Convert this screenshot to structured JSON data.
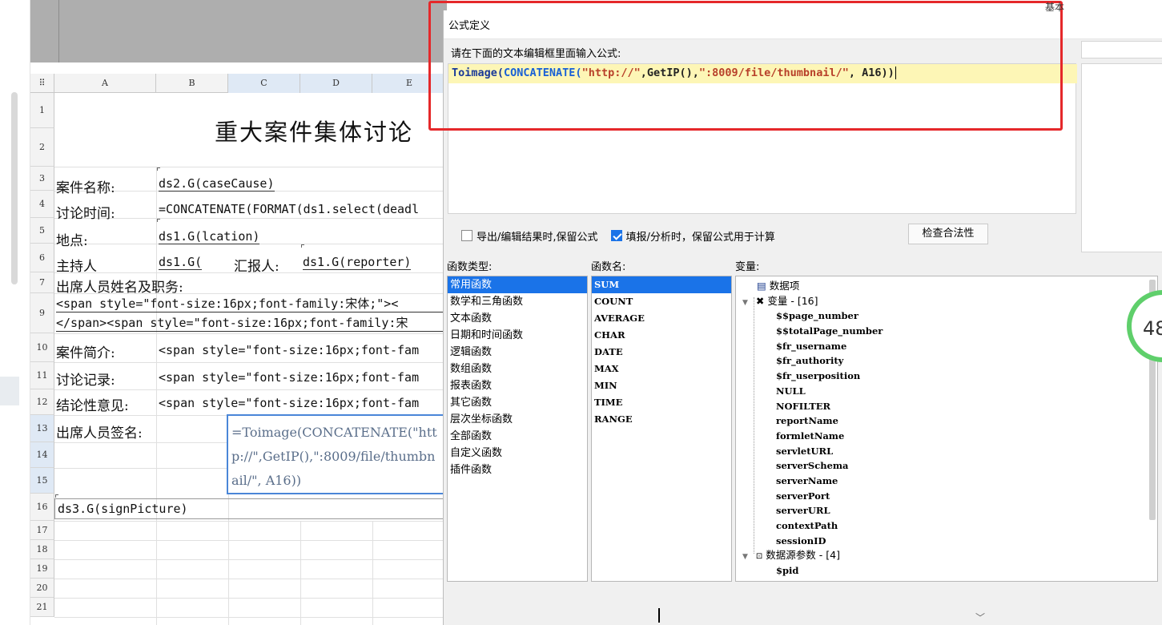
{
  "sheet": {
    "columns": [
      "A",
      "B",
      "C",
      "D",
      "E"
    ],
    "rows": [
      "1",
      "2",
      "3",
      "4",
      "5",
      "6",
      "7",
      "9",
      "10",
      "11",
      "12",
      "13",
      "14",
      "15",
      "16",
      "17",
      "18",
      "19",
      "20",
      "21"
    ],
    "title": "重大案件集体讨论",
    "cells": {
      "r3_label": "案件名称:",
      "r3_value": "ds2.G(caseCause)",
      "r4_label": "讨论时间:",
      "r4_value": "=CONCATENATE(FORMAT(ds1.select(deadl",
      "r5_label": "地点:",
      "r5_value": "ds1.G(lcation)",
      "r6_label": "主持人",
      "r6_value": "ds1.G(",
      "r6_label2": "汇报人:",
      "r6_value2": "ds1.G(reporter)",
      "r7_label": "出席人员姓名及职务:",
      "r9_line1": "<span style=\"font-size:16px;font-family:宋体;\"><",
      "r9_line2": "</span><span style=\"font-size:16px;font-family:宋",
      "r10_label": "案件简介:",
      "r10_value": "<span style=\"font-size:16px;font-fam",
      "r11_label": "讨论记录:",
      "r11_value": "<span style=\"font-size:16px;font-fam",
      "r12_label": "结论性意见:",
      "r12_value": "<span style=\"font-size:16px;font-fam",
      "r13_label": "出席人员签名:",
      "r13_formula": "=Toimage(CONCATENATE(\"http://\",GetIP(),\":8009/file/thumbnail/\", A16))",
      "r16_value": "ds3.G(signPicture)"
    }
  },
  "dialog": {
    "title": "公式定义",
    "instruction": "请在下面的文本编辑框里面输入公式:",
    "formula_tokens": {
      "t1": "Toimage(",
      "t2": "CONCATENATE(",
      "t3": "\"http://\"",
      "t4": ",GetIP(),",
      "t5": "\":8009/file/thumbnail/\"",
      "t6": ", A16))"
    },
    "option_export": "导出/编辑结果时,保留公式",
    "option_fill": "填报/分析时，保留公式用于计算",
    "check_button": "检查合法性",
    "labels": {
      "fn_type": "函数类型:",
      "fn_name": "函数名:",
      "variables": "变量:"
    },
    "fn_types": [
      "常用函数",
      "数学和三角函数",
      "文本函数",
      "日期和时间函数",
      "逻辑函数",
      "数组函数",
      "报表函数",
      "其它函数",
      "层次坐标函数",
      "全部函数",
      "自定义函数",
      "插件函数"
    ],
    "fn_names": [
      "SUM",
      "COUNT",
      "AVERAGE",
      "CHAR",
      "DATE",
      "MAX",
      "MIN",
      "TIME",
      "RANGE"
    ],
    "tree": {
      "data_item": "数据项",
      "variables_group": "变量 - [16]",
      "variables": [
        "$$page_number",
        "$$totalPage_number",
        "$fr_username",
        "$fr_authority",
        "$fr_userposition",
        "NULL",
        "NOFILTER",
        "reportName",
        "formletName",
        "servletURL",
        "serverSchema",
        "serverName",
        "serverPort",
        "serverURL",
        "contextPath",
        "sessionID"
      ],
      "ds_params_group": "数据源参数 - [4]",
      "ds_params": [
        "$pid"
      ]
    }
  },
  "widget": {
    "progress": "48",
    "top_text": "基本"
  },
  "colors": {
    "accent": "#1a73e8",
    "annotation": "#e5282a",
    "formula_highlight": "#fdf6b6",
    "progress_ring": "#5fcf6b"
  },
  "icons": [
    "check-icon",
    "tree-collapse-icon",
    "data-item-icon",
    "variables-icon",
    "ds-param-icon",
    "chevron-down-icon"
  ]
}
